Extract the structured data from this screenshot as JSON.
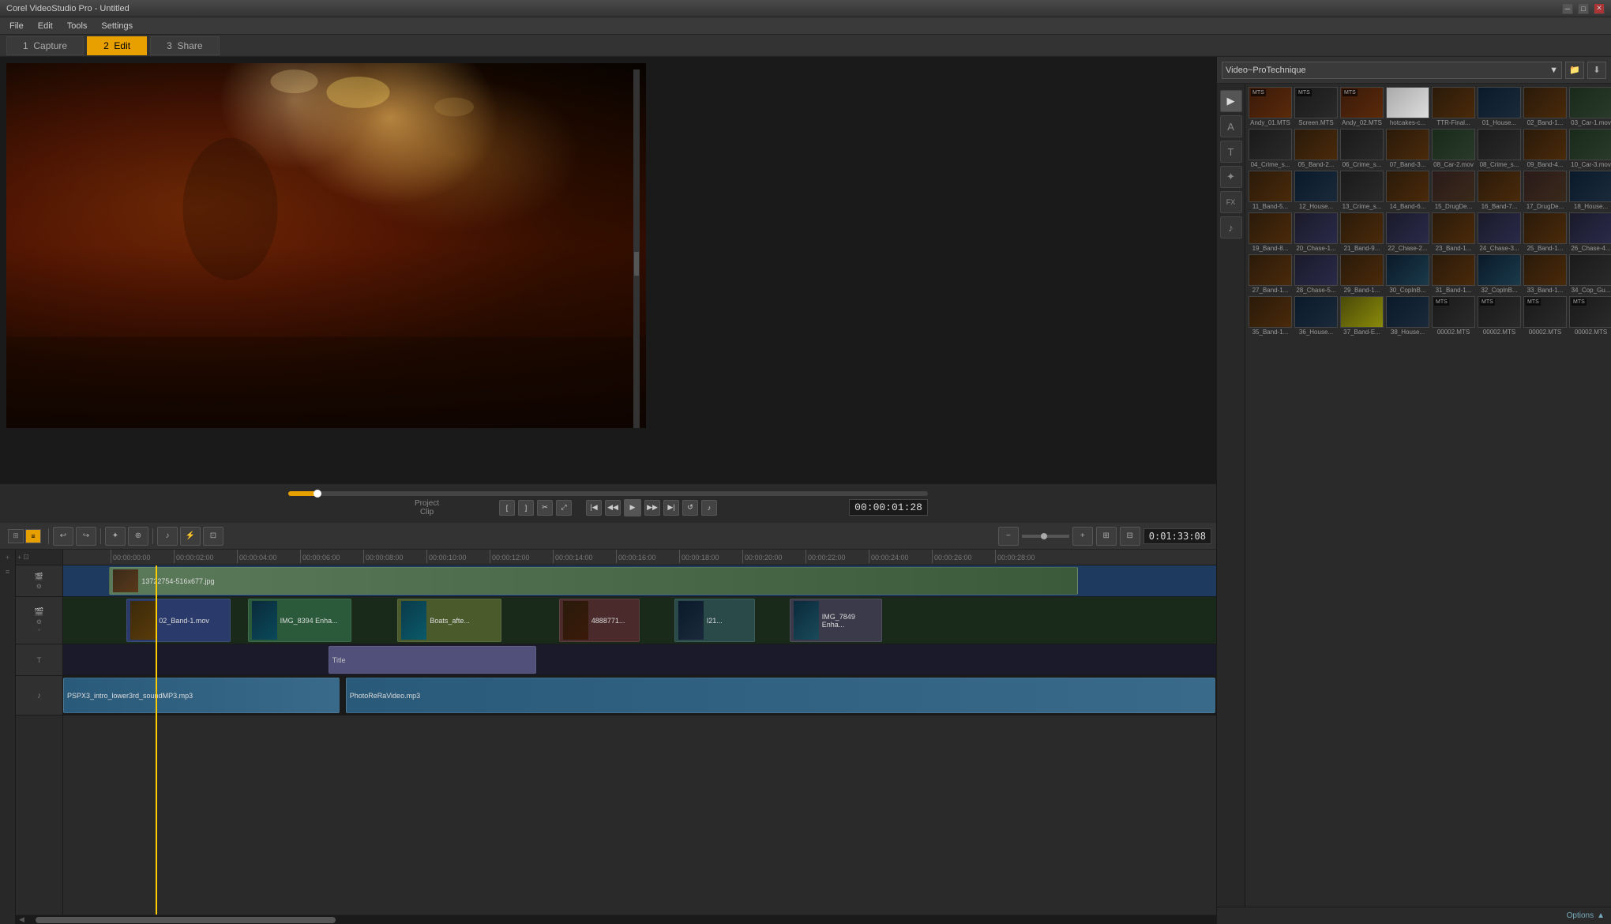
{
  "app": {
    "title": "Corel VideoStudio Pro - Untitled",
    "window_controls": [
      "minimize",
      "maximize",
      "close"
    ]
  },
  "menubar": {
    "items": [
      "File",
      "Edit",
      "Tools",
      "Settings"
    ]
  },
  "workflow": {
    "tabs": [
      {
        "id": "capture",
        "number": "1",
        "label": "Capture"
      },
      {
        "id": "edit",
        "number": "2",
        "label": "Edit",
        "active": true
      },
      {
        "id": "share",
        "number": "3",
        "label": "Share"
      }
    ]
  },
  "preview": {
    "timecode": "00:00:01:28",
    "project_label": "Project",
    "clip_label": "Clip"
  },
  "library": {
    "dropdown_label": "Video~ProTechnique",
    "options_label": "Options",
    "media_items": [
      {
        "id": 1,
        "name": "Andy_01.MTS",
        "label": "MTS",
        "type": "concert"
      },
      {
        "id": 2,
        "name": "Screen.MTS",
        "label": "MTS",
        "type": "dark"
      },
      {
        "id": 3,
        "name": "Andy_02.MTS",
        "label": "MTS",
        "type": "concert"
      },
      {
        "id": 4,
        "name": "hotcakes-c...",
        "label": "",
        "type": "white"
      },
      {
        "id": 5,
        "name": "TTR-Final...",
        "label": "",
        "type": "band"
      },
      {
        "id": 6,
        "name": "01_House...",
        "label": "",
        "type": "house"
      },
      {
        "id": 7,
        "name": "02_Band-1...",
        "label": "",
        "type": "band"
      },
      {
        "id": 8,
        "name": "03_Car-1.mov",
        "label": "",
        "type": "car"
      },
      {
        "id": 9,
        "name": "04_Crime_s...",
        "label": "",
        "type": "dark"
      },
      {
        "id": 10,
        "name": "05_Band-2...",
        "label": "",
        "type": "band"
      },
      {
        "id": 11,
        "name": "06_Crime_s...",
        "label": "",
        "type": "dark"
      },
      {
        "id": 12,
        "name": "07_Band-3...",
        "label": "",
        "type": "band"
      },
      {
        "id": 13,
        "name": "08_Car-2.mov",
        "label": "",
        "type": "car"
      },
      {
        "id": 14,
        "name": "08_Crime_s...",
        "label": "",
        "type": "dark"
      },
      {
        "id": 15,
        "name": "09_Band-4...",
        "label": "",
        "type": "band"
      },
      {
        "id": 16,
        "name": "10_Car-3.mov",
        "label": "",
        "type": "car"
      },
      {
        "id": 17,
        "name": "11_Band-5...",
        "label": "",
        "type": "band"
      },
      {
        "id": 18,
        "name": "12_House...",
        "label": "",
        "type": "house"
      },
      {
        "id": 19,
        "name": "13_Crime_s...",
        "label": "",
        "type": "dark"
      },
      {
        "id": 20,
        "name": "14_Band-6...",
        "label": "",
        "type": "band"
      },
      {
        "id": 21,
        "name": "15_DrugDe...",
        "label": "",
        "type": "drug"
      },
      {
        "id": 22,
        "name": "16_Band-7...",
        "label": "",
        "type": "band"
      },
      {
        "id": 23,
        "name": "17_DrugDe...",
        "label": "",
        "type": "drug"
      },
      {
        "id": 24,
        "name": "18_House...",
        "label": "",
        "type": "house"
      },
      {
        "id": 25,
        "name": "19_Band-8...",
        "label": "",
        "type": "band"
      },
      {
        "id": 26,
        "name": "20_Chase-1...",
        "label": "",
        "type": "chase"
      },
      {
        "id": 27,
        "name": "21_Band-9...",
        "label": "",
        "type": "band"
      },
      {
        "id": 28,
        "name": "22_Chase-2...",
        "label": "",
        "type": "chase"
      },
      {
        "id": 29,
        "name": "23_Band-1...",
        "label": "",
        "type": "band"
      },
      {
        "id": 30,
        "name": "24_Chase-3...",
        "label": "",
        "type": "chase"
      },
      {
        "id": 31,
        "name": "25_Band-1...",
        "label": "",
        "type": "band"
      },
      {
        "id": 32,
        "name": "26_Chase-4...",
        "label": "",
        "type": "chase"
      },
      {
        "id": 33,
        "name": "27_Band-1...",
        "label": "",
        "type": "band"
      },
      {
        "id": 34,
        "name": "28_Chase-5...",
        "label": "",
        "type": "chase"
      },
      {
        "id": 35,
        "name": "29_Band-1...",
        "label": "",
        "type": "band"
      },
      {
        "id": 36,
        "name": "30_CoplnB...",
        "label": "",
        "type": "cop"
      },
      {
        "id": 37,
        "name": "31_Band-1...",
        "label": "",
        "type": "band"
      },
      {
        "id": 38,
        "name": "32_CoplnB...",
        "label": "",
        "type": "cop"
      },
      {
        "id": 39,
        "name": "33_Band-1...",
        "label": "",
        "type": "band"
      },
      {
        "id": 40,
        "name": "34_Cop_Gu...",
        "label": "",
        "type": "cop"
      },
      {
        "id": 41,
        "name": "35_Band-1...",
        "label": "",
        "type": "band"
      },
      {
        "id": 42,
        "name": "36_House...",
        "label": "",
        "type": "house"
      },
      {
        "id": 43,
        "name": "37_Band-E...",
        "label": "",
        "type": "band"
      },
      {
        "id": 44,
        "name": "38_House...",
        "label": "",
        "type": "house"
      },
      {
        "id": 45,
        "name": "00002.MTS",
        "label": "MTS",
        "type": "dark"
      },
      {
        "id": 46,
        "name": "00002.MTS",
        "label": "MTS",
        "type": "dark"
      },
      {
        "id": 47,
        "name": "00002.MTS",
        "label": "MTS",
        "type": "dark"
      },
      {
        "id": 48,
        "name": "00002.MTS",
        "label": "MTS",
        "type": "dark"
      }
    ]
  },
  "timeline": {
    "duration": "0:01:33:08",
    "ruler_marks": [
      "00:00:00:00",
      "00:00:02:00",
      "00:00:04:00",
      "00:00:06:00",
      "00:00:08:00",
      "00:00:10:00",
      "00:00:12:00",
      "00:00:14:00",
      "00:00:16:00",
      "00:00:18:00",
      "00:00:20:00",
      "00:00:22:00",
      "00:00:24:00",
      "00:00:26:00",
      "00:00:28:00"
    ],
    "tracks": {
      "photo": {
        "clip_name": "13722754-516x677.jpg"
      },
      "video": {
        "clips": [
          {
            "name": "02_Band-1.mov",
            "type": "band"
          },
          {
            "name": "IMG_8394 Enha...",
            "type": "boat"
          },
          {
            "name": "Boats_afte...",
            "type": "boat"
          },
          {
            "name": "4888771...",
            "type": "dark"
          },
          {
            "name": "I21...",
            "type": "house"
          },
          {
            "name": "IMG_7849 Enha...",
            "type": "boat"
          }
        ]
      },
      "title": {
        "clip_name": "Title"
      },
      "audio": {
        "clips": [
          {
            "name": "PSPX3_intro_lower3rd_soundMP3.mp3"
          },
          {
            "name": "PhotoReRaVideo.mp3"
          }
        ]
      }
    },
    "toolbar_buttons": [
      {
        "id": "storyboard",
        "icon": "⊞",
        "label": "Storyboard view"
      },
      {
        "id": "timeline",
        "icon": "≡",
        "label": "Timeline view",
        "active": true
      },
      {
        "id": "undo",
        "icon": "↩",
        "label": "Undo"
      },
      {
        "id": "redo",
        "icon": "↪",
        "label": "Redo"
      },
      {
        "id": "fx",
        "icon": "✦",
        "label": "Add effects"
      },
      {
        "id": "insert",
        "icon": "⊕",
        "label": "Insert"
      },
      {
        "id": "audio",
        "icon": "♪",
        "label": "Audio mix"
      },
      {
        "id": "zoom-in",
        "icon": "+",
        "label": "Zoom in"
      },
      {
        "id": "zoom-out",
        "icon": "−",
        "label": "Zoom out"
      }
    ]
  },
  "side_icons": [
    {
      "id": "media",
      "icon": "▶",
      "label": "Media",
      "active": true
    },
    {
      "id": "instant",
      "icon": "A",
      "label": "Instant project"
    },
    {
      "id": "text",
      "icon": "T",
      "label": "Titles"
    },
    {
      "id": "graphics",
      "icon": "✦",
      "label": "Graphics"
    },
    {
      "id": "fx",
      "icon": "FX",
      "label": "Effects"
    },
    {
      "id": "music",
      "icon": "♪",
      "label": "Music"
    }
  ]
}
